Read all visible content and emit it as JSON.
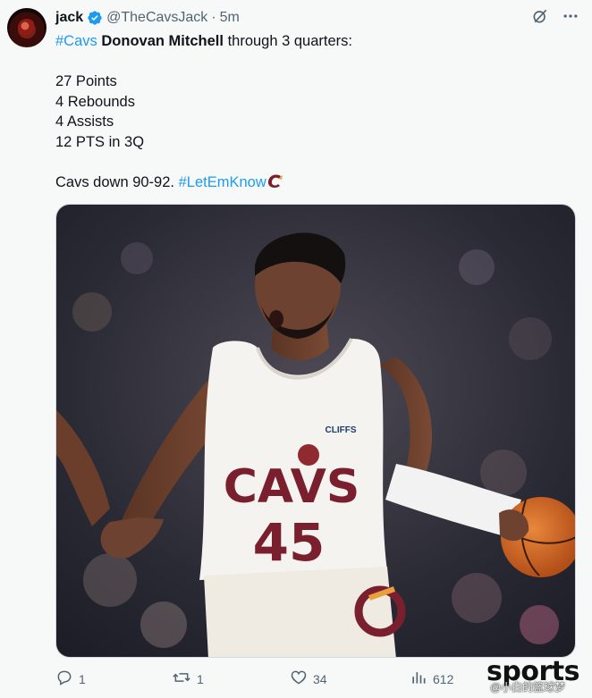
{
  "author": {
    "name": "jack",
    "handle": "@TheCavsJack",
    "separator": "·",
    "time": "5m"
  },
  "tweet": {
    "line1": {
      "hashtag": "#Cavs",
      "bold": "Donovan Mitchell",
      "rest": "through 3 quarters:"
    },
    "stats": [
      "27 Points",
      "4 Rebounds",
      "4 Assists",
      "12 PTS in 3Q"
    ],
    "closing": {
      "text": "Cavs down 90-92.",
      "hashtag": "#LetEmKnow"
    }
  },
  "media": {
    "jersey_team": "CAVS",
    "jersey_number": "45",
    "jersey_sponsor": "CLIFFS"
  },
  "actions": {
    "replies": "1",
    "reposts": "1",
    "likes": "34",
    "views": "612"
  },
  "watermark": {
    "brand": "sports",
    "caption": "@小白的篮球梦"
  },
  "colors": {
    "accent": "#1d9bf0",
    "text": "#0f1419",
    "secondary": "#536471",
    "background": "#f7f9f9",
    "wine": "#7a1f2e"
  },
  "icons": [
    "verified-badge-icon",
    "grok-icon",
    "more-icon",
    "reply-icon",
    "repost-icon",
    "like-icon",
    "views-icon",
    "cavs-logo-icon"
  ]
}
